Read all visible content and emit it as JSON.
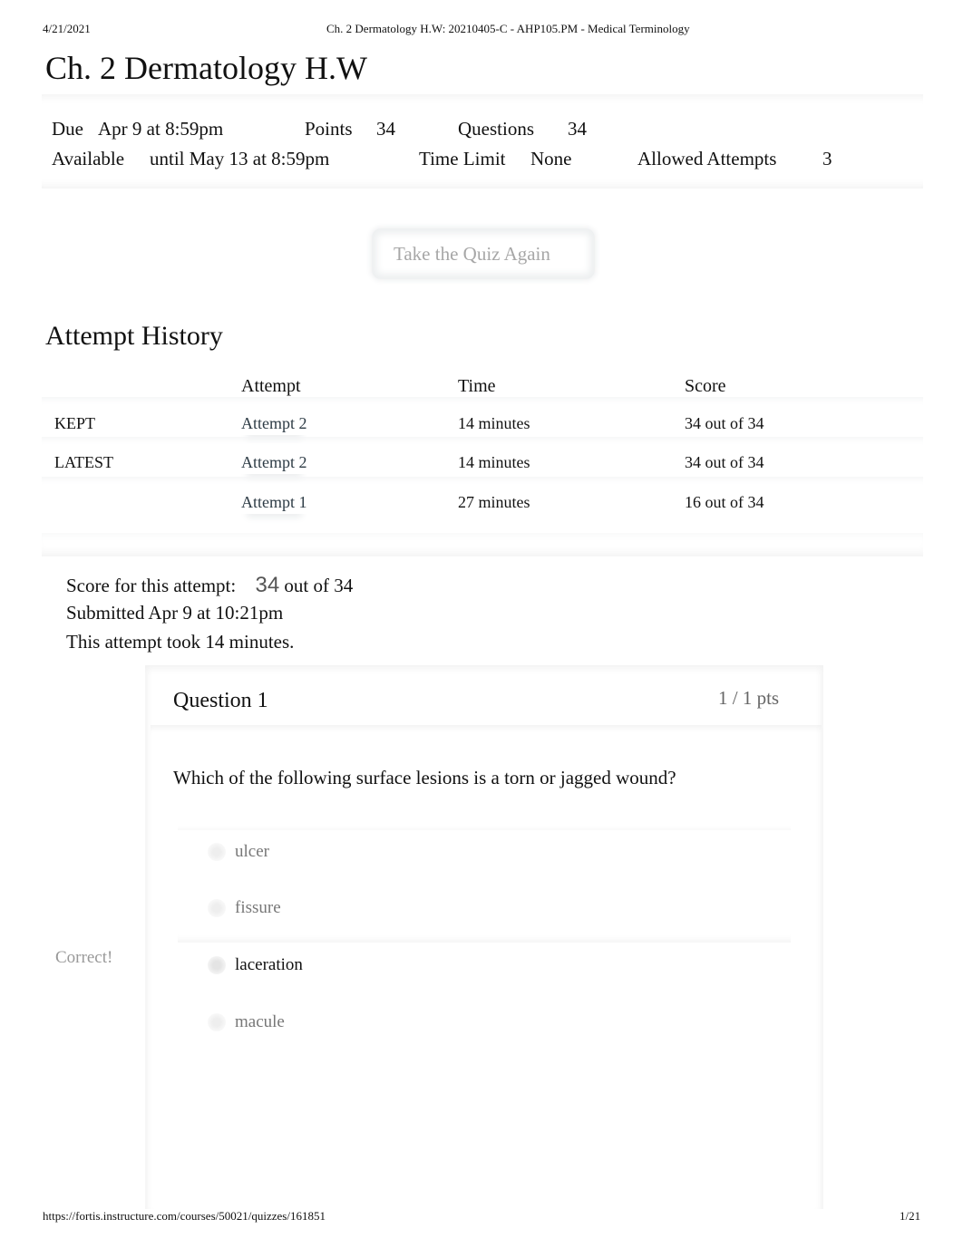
{
  "print_header": {
    "date": "4/21/2021",
    "document_title": "Ch. 2 Dermatology H.W: 20210405-C - AHP105.PM - Medical Terminology"
  },
  "quiz": {
    "title": "Ch. 2 Dermatology H.W",
    "details": {
      "due_label": "Due",
      "due_value": "Apr 9 at 8:59pm",
      "points_label": "Points",
      "points_value": "34",
      "questions_label": "Questions",
      "questions_value": "34",
      "available_label": "Available",
      "available_value": "until May 13 at 8:59pm",
      "time_limit_label": "Time Limit",
      "time_limit_value": "None",
      "allowed_attempts_label": "Allowed Attempts",
      "allowed_attempts_value": "3"
    },
    "take_again_label": "Take the Quiz Again"
  },
  "attempt_history": {
    "title": "Attempt History",
    "columns": [
      "",
      "Attempt",
      "Time",
      "Score"
    ],
    "rows": [
      {
        "tag": "KEPT",
        "attempt": "Attempt 2",
        "time": "14 minutes",
        "score": "34 out of 34"
      },
      {
        "tag": "LATEST",
        "attempt": "Attempt 2",
        "time": "14 minutes",
        "score": "34 out of 34"
      },
      {
        "tag": "",
        "attempt": "Attempt 1",
        "time": "27 minutes",
        "score": "16 out of 34"
      }
    ]
  },
  "summary": {
    "score_label": "Score for this attempt:",
    "score_value": "34",
    "score_suffix": "out of 34",
    "submitted": "Submitted Apr 9 at 10:21pm",
    "duration": "This attempt took 14 minutes."
  },
  "question": {
    "title": "Question 1",
    "points": "1 / 1 pts",
    "text": "Which of the following surface lesions is a torn or jagged wound?",
    "correct_flag": "Correct!",
    "answers": [
      {
        "label": "ulcer",
        "selected": false
      },
      {
        "label": "fissure",
        "selected": false
      },
      {
        "label": "laceration",
        "selected": true
      },
      {
        "label": "macule",
        "selected": false
      }
    ]
  },
  "print_footer": {
    "url": "https://fortis.instructure.com/courses/50021/quizzes/161851",
    "page": "1/21"
  }
}
